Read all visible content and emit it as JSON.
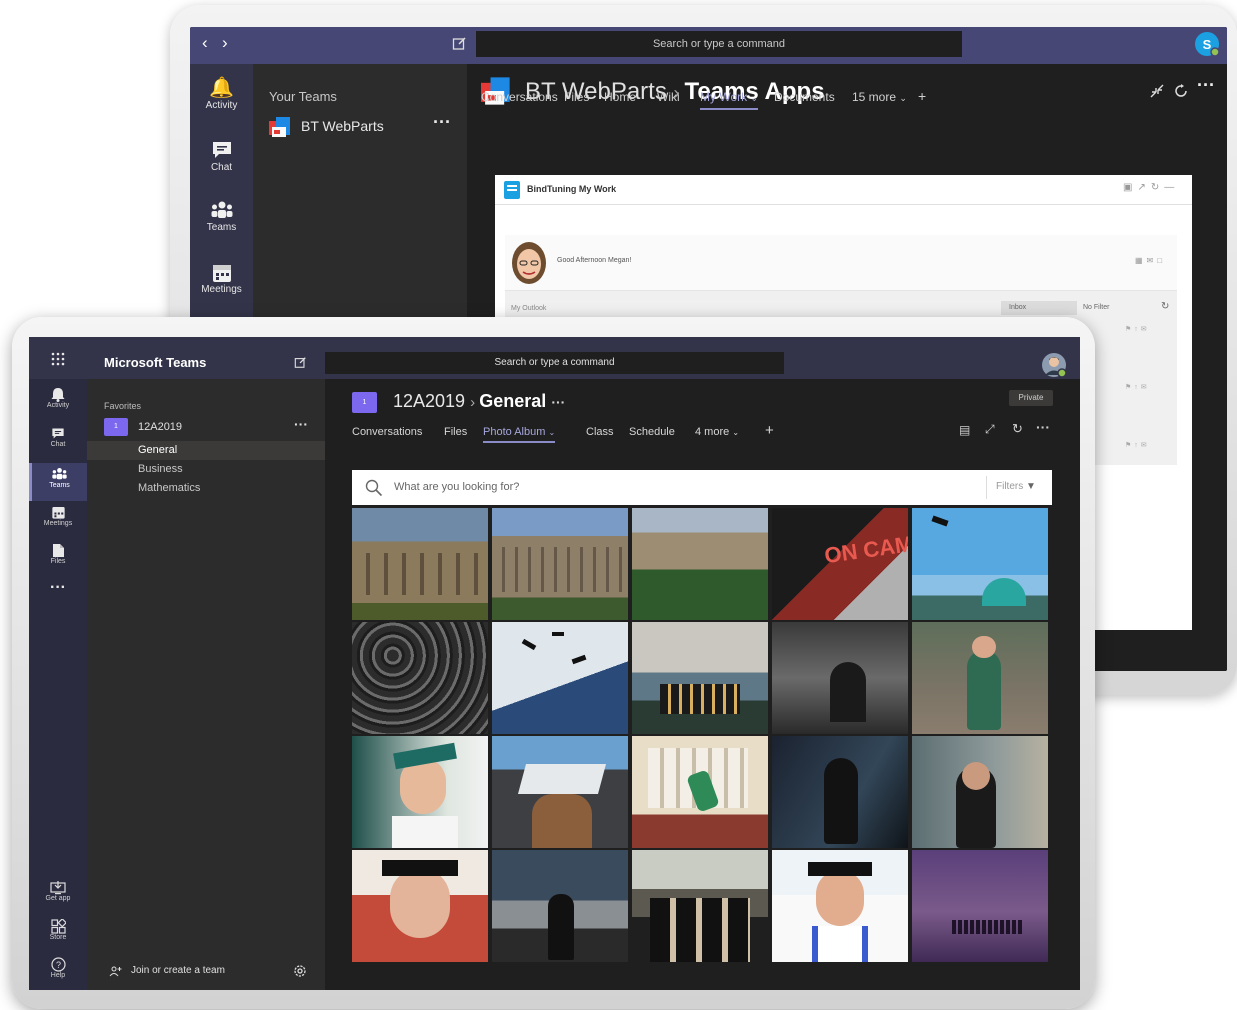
{
  "back_window": {
    "search_placeholder": "Search or type a command",
    "rail": [
      {
        "label": "Activity",
        "icon": "bell-icon"
      },
      {
        "label": "Chat",
        "icon": "chat-icon"
      },
      {
        "label": "Teams",
        "icon": "teams-icon"
      },
      {
        "label": "Meetings",
        "icon": "calendar-icon"
      }
    ],
    "your_teams_label": "Your Teams",
    "team_name": "BT WebParts",
    "breadcrumb_team": "BT WebParts",
    "breadcrumb_app": "Teams Apps",
    "tabs": [
      "Conversations",
      "Files",
      "Home",
      "Wiki",
      "My Work",
      "Documents",
      "15 more"
    ],
    "active_tab": "My Work",
    "card_title": "BindTuning My Work",
    "greeting": "Good Afternoon Megan!",
    "outlook_label": "My Outlook",
    "inbox_select": "Inbox",
    "filter_select": "No Filter"
  },
  "front_window": {
    "app_title": "Microsoft Teams",
    "search_placeholder": "Search or type a command",
    "rail": [
      {
        "label": "Activity",
        "icon": "bell-icon"
      },
      {
        "label": "Chat",
        "icon": "chat-icon"
      },
      {
        "label": "Teams",
        "icon": "teams-icon"
      },
      {
        "label": "Meetings",
        "icon": "calendar-icon"
      },
      {
        "label": "Files",
        "icon": "files-icon"
      }
    ],
    "rail_bottom": [
      {
        "label": "Get app",
        "icon": "download-icon"
      },
      {
        "label": "Store",
        "icon": "store-icon"
      },
      {
        "label": "Help",
        "icon": "help-icon"
      }
    ],
    "favorites_label": "Favorites",
    "team_name": "12A2019",
    "team_badge": "1",
    "channels": [
      "General",
      "Business",
      "Mathematics"
    ],
    "active_channel": "General",
    "join_label": "Join or create a team",
    "breadcrumb_team": "12A2019",
    "breadcrumb_channel": "General",
    "private_badge": "Private",
    "tabs": [
      "Conversations",
      "Files",
      "Photo Album",
      "Class",
      "Schedule",
      "4 more"
    ],
    "active_tab": "Photo Album",
    "album_search_placeholder": "What are you looking for?",
    "filters_label": "Filters",
    "campus_sign_text": "ON CAMPUS"
  },
  "colors": {
    "teams_purple": "#464775",
    "teams_accent": "#6264a7",
    "badge_purple": "#7b68ee",
    "dark_bg": "#1f1f1f",
    "skype_blue": "#1ba1e2"
  }
}
